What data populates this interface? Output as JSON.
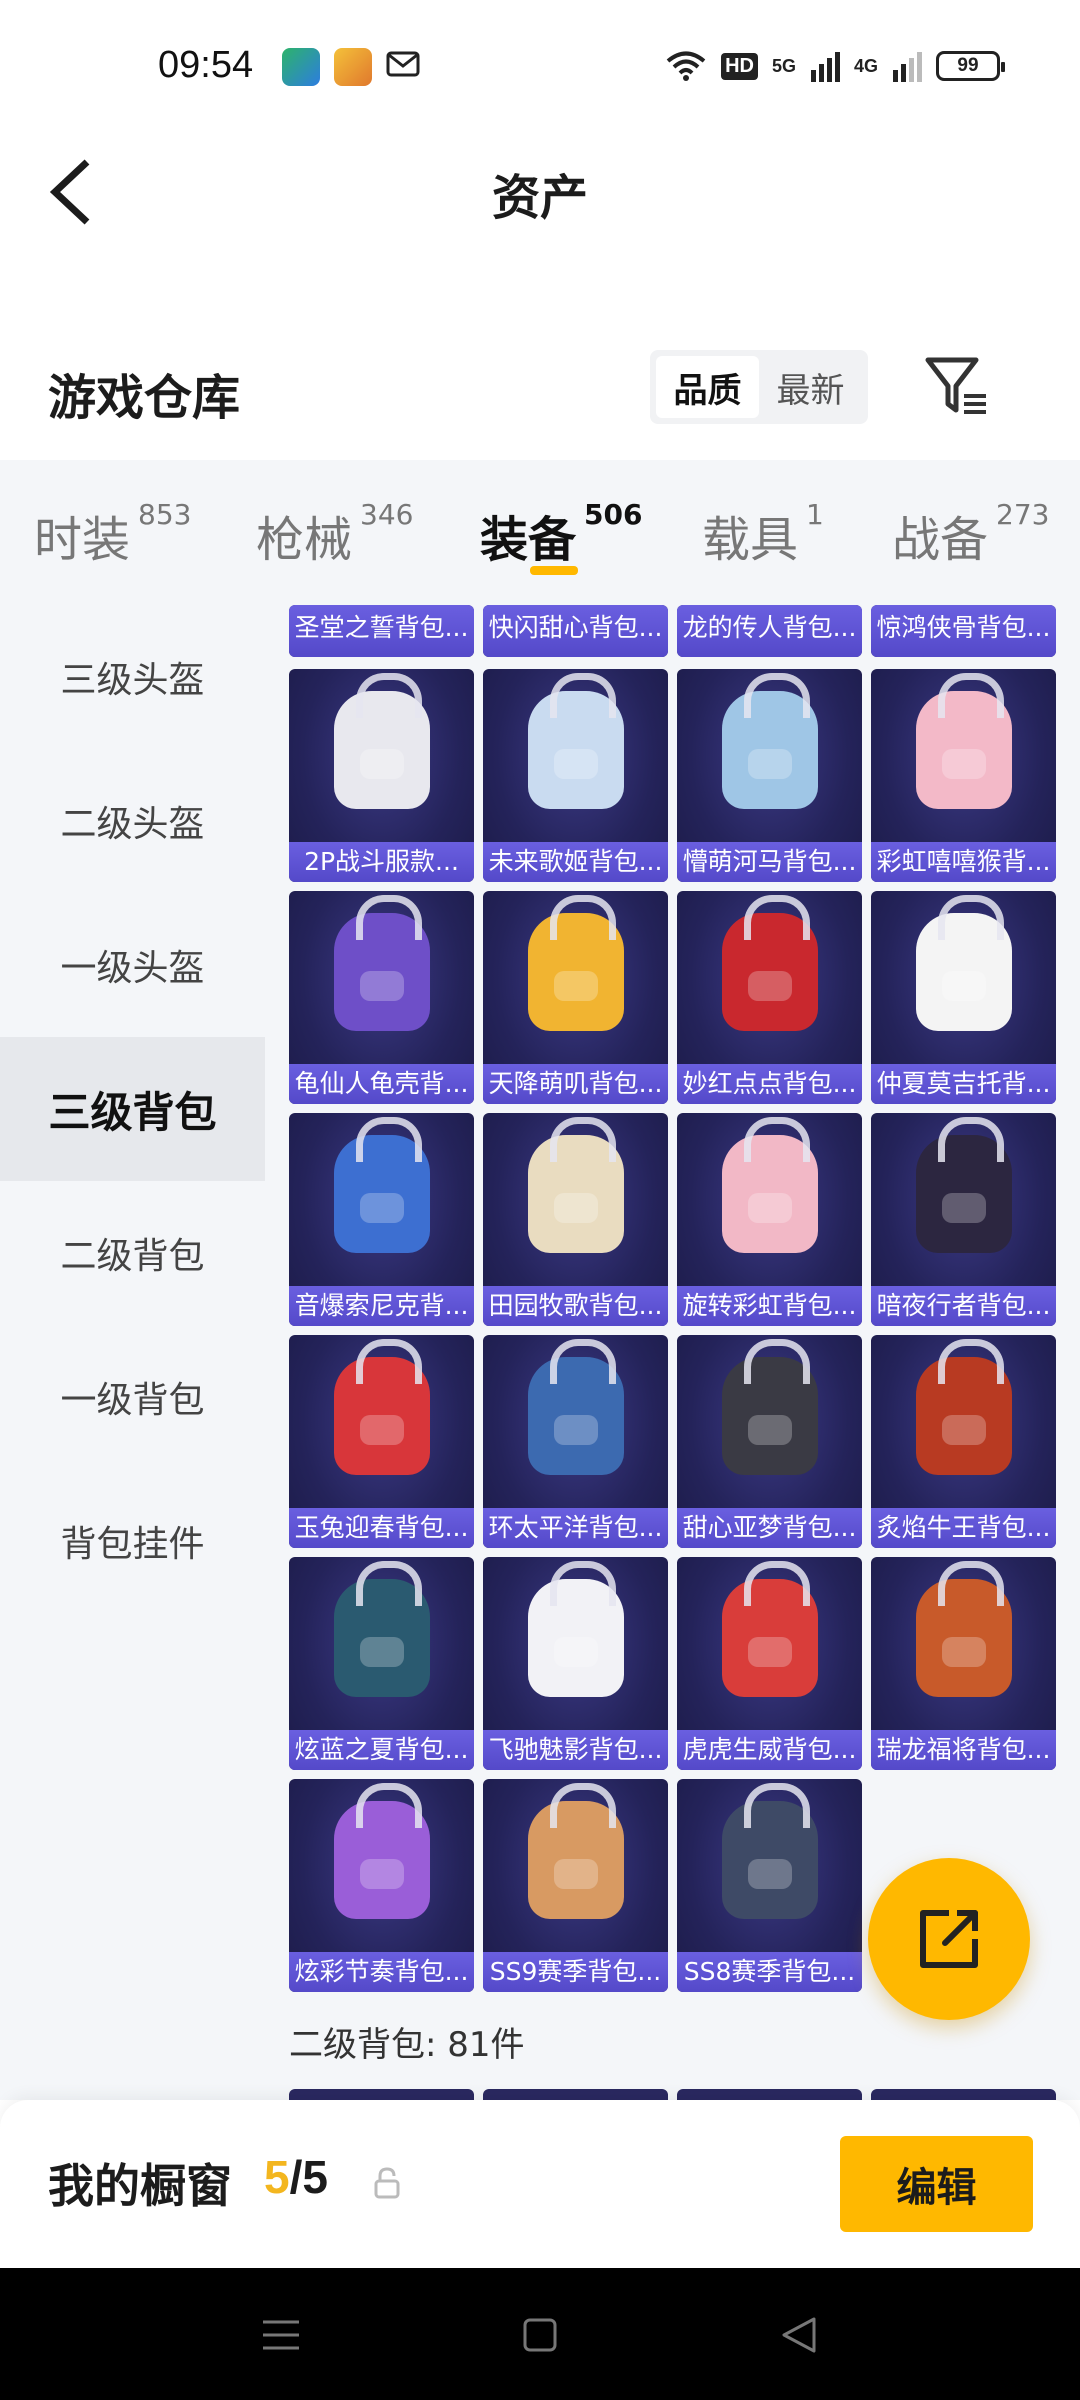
{
  "status_bar": {
    "time": "09:54",
    "hd_badge": "HD",
    "signal_5g": "5G",
    "signal_4g": "4G",
    "battery": "99",
    "icons": [
      "app-icon",
      "app-icon",
      "mail-icon",
      "wifi-icon",
      "signal-icon"
    ]
  },
  "header": {
    "title": "资产",
    "back_icon": "chevron-left-icon"
  },
  "warehouse": {
    "title": "游戏仓库",
    "sort_options": [
      "品质",
      "最新"
    ],
    "active_sort": "品质",
    "filter_icon": "filter-icon"
  },
  "categories": [
    {
      "label": "时装",
      "count": "853"
    },
    {
      "label": "枪械",
      "count": "346"
    },
    {
      "label": "装备",
      "count": "506",
      "active": true
    },
    {
      "label": "载具",
      "count": "1"
    },
    {
      "label": "战备",
      "count": "273"
    }
  ],
  "sidebar": {
    "items": [
      "三级头盔",
      "二级头盔",
      "一级头盔",
      "三级背包",
      "二级背包",
      "一级背包",
      "背包挂件"
    ],
    "active": "三级背包"
  },
  "grid": {
    "top_row": [
      "圣堂之誓背包...",
      "快闪甜心背包...",
      "龙的传人背包...",
      "惊鸿侠骨背包..."
    ],
    "items": [
      "2P战斗服款...",
      "未来歌姬背包...",
      "懵萌河马背包...",
      "彩虹嘻嘻猴背...",
      "龟仙人龟壳背...",
      "天降萌叽背包...",
      "妙红点点背包...",
      "仲夏莫吉托背...",
      "音爆索尼克背...",
      "田园牧歌背包...",
      "旋转彩虹背包...",
      "暗夜行者背包...",
      "玉兔迎春背包...",
      "环太平洋背包...",
      "甜心亚梦背包...",
      "炙焰牛王背包...",
      "炫蓝之夏背包...",
      "飞驰魅影背包...",
      "虎虎生威背包...",
      "瑞龙福将背包...",
      "炫彩节奏背包...",
      "SS9赛季背包...",
      "SS8赛季背包..."
    ],
    "bag_colors": [
      "#e8e8ee",
      "#c9dbf0",
      "#9fc6e6",
      "#f3b9c8",
      "#6e4fc8",
      "#f1b431",
      "#c9282e",
      "#f4f4f4",
      "#3d6fd1",
      "#e9dcc0",
      "#f2b8c6",
      "#2c2640",
      "#d8363a",
      "#3c6ab0",
      "#3a3a44",
      "#b83a22",
      "#2a5a70",
      "#f2f2f6",
      "#d93d3a",
      "#c85a2a",
      "#9a5ed8",
      "#d89a62",
      "#3e4a66"
    ],
    "section_label": "二级背包: 81件"
  },
  "fab": {
    "icon": "share-export-icon"
  },
  "showcase": {
    "label": "我的橱窗",
    "current": "5",
    "separator": "/",
    "total": "5",
    "lock_icon": "lock-icon",
    "edit_label": "编辑"
  },
  "nav_bar": {
    "icons": [
      "menu-icon",
      "home-icon",
      "back-icon"
    ]
  },
  "colors": {
    "accent": "#ffb800",
    "card_bg": "#24235a",
    "card_caption": "#5c51d0"
  }
}
